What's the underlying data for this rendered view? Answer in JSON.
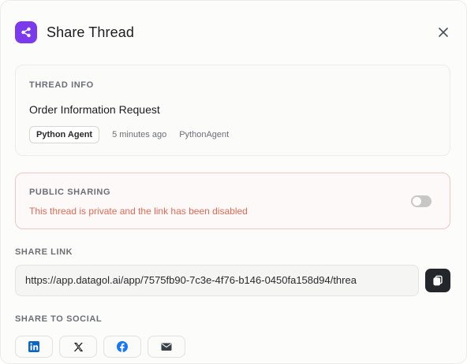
{
  "header": {
    "title": "Share Thread",
    "icon": "share-icon",
    "close_icon": "close-icon",
    "accent": "#7c3aed"
  },
  "thread_info": {
    "label": "THREAD INFO",
    "name": "Order Information Request",
    "badge": "Python Agent",
    "time": "5 minutes ago",
    "author": "PythonAgent"
  },
  "public_sharing": {
    "label": "PUBLIC SHARING",
    "message": "This thread is private and the link has been disabled",
    "enabled": false,
    "message_color": "#e06a55"
  },
  "share_link": {
    "label": "SHARE LINK",
    "url": "https://app.datagol.ai/app/7575fb90-7c3e-4f76-b146-0450fa158d94/threa",
    "copy_icon": "copy-icon"
  },
  "social": {
    "label": "SHARE TO SOCIAL",
    "items": [
      {
        "name": "linkedin",
        "icon": "linkedin-icon",
        "color": "#0a66c2"
      },
      {
        "name": "x",
        "icon": "x-icon",
        "color": "#111111"
      },
      {
        "name": "facebook",
        "icon": "facebook-icon",
        "color": "#1877f2"
      },
      {
        "name": "email",
        "icon": "email-icon",
        "color": "#3a3f45"
      }
    ]
  }
}
